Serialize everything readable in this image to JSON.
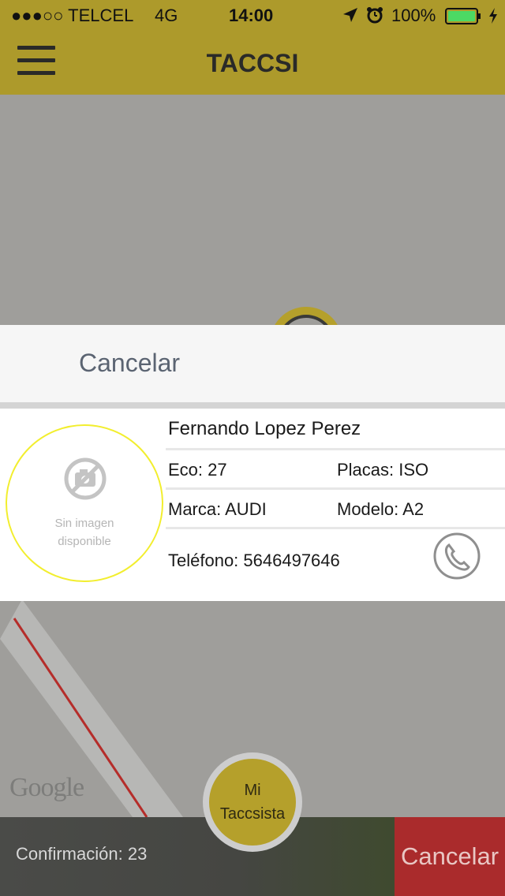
{
  "status_bar": {
    "carrier": "●●●○○ TELCEL",
    "network": "4G",
    "time": "14:00",
    "battery": "100%"
  },
  "header": {
    "title": "TACCSI"
  },
  "map": {
    "provider_logo": "Google"
  },
  "panel": {
    "cancel_label": "Cancelar"
  },
  "driver": {
    "photo_placeholder_line1": "Sin imagen",
    "photo_placeholder_line2": "disponible",
    "name": "Fernando Lopez Perez",
    "eco": "Eco: 27",
    "placas": "Placas: ISO",
    "marca": "Marca: AUDI",
    "modelo": "Modelo: A2",
    "telefono": "Teléfono: 5646497646"
  },
  "bottom": {
    "confirmation": "Confirmación: 23",
    "cancel_label": "Cancelar"
  },
  "fab": {
    "line1": "Mi",
    "line2": "Taccsista"
  },
  "colors": {
    "brand": "#ad9a2b",
    "danger": "#aa2b2c",
    "map": "#9f9e9b",
    "battery": "#4cd964"
  },
  "icons": [
    "menu-icon",
    "location-arrow-icon",
    "alarm-icon",
    "battery-icon",
    "charging-icon",
    "no-camera-icon",
    "phone-icon"
  ]
}
